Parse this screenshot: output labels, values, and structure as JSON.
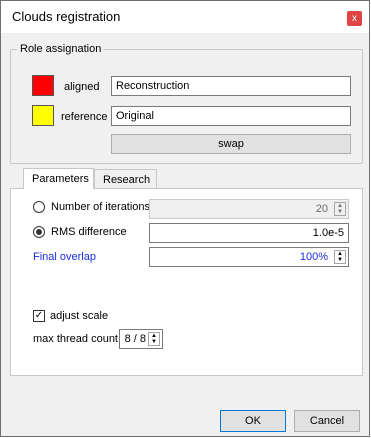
{
  "window": {
    "title": "Clouds registration",
    "close_symbol": "x"
  },
  "role": {
    "group_title": "Role assignation",
    "aligned_label": "aligned",
    "aligned_value": "Reconstruction",
    "aligned_color": "#ff0000",
    "reference_label": "reference",
    "reference_value": "Original",
    "reference_color": "#ffff00",
    "swap_label": "swap"
  },
  "tabs": {
    "parameters": "Parameters",
    "research": "Research"
  },
  "params": {
    "iterations_label": "Number of iterations",
    "iterations_value": "20",
    "rms_label": "RMS difference",
    "rms_value": "1.0e-5",
    "overlap_label": "Final overlap",
    "overlap_value": "100%",
    "overlap_color": "#1a2ee0",
    "adjust_scale_label": "adjust scale",
    "thread_label": "max thread count",
    "thread_value": "8 / 8"
  },
  "footer": {
    "ok": "OK",
    "cancel": "Cancel"
  }
}
